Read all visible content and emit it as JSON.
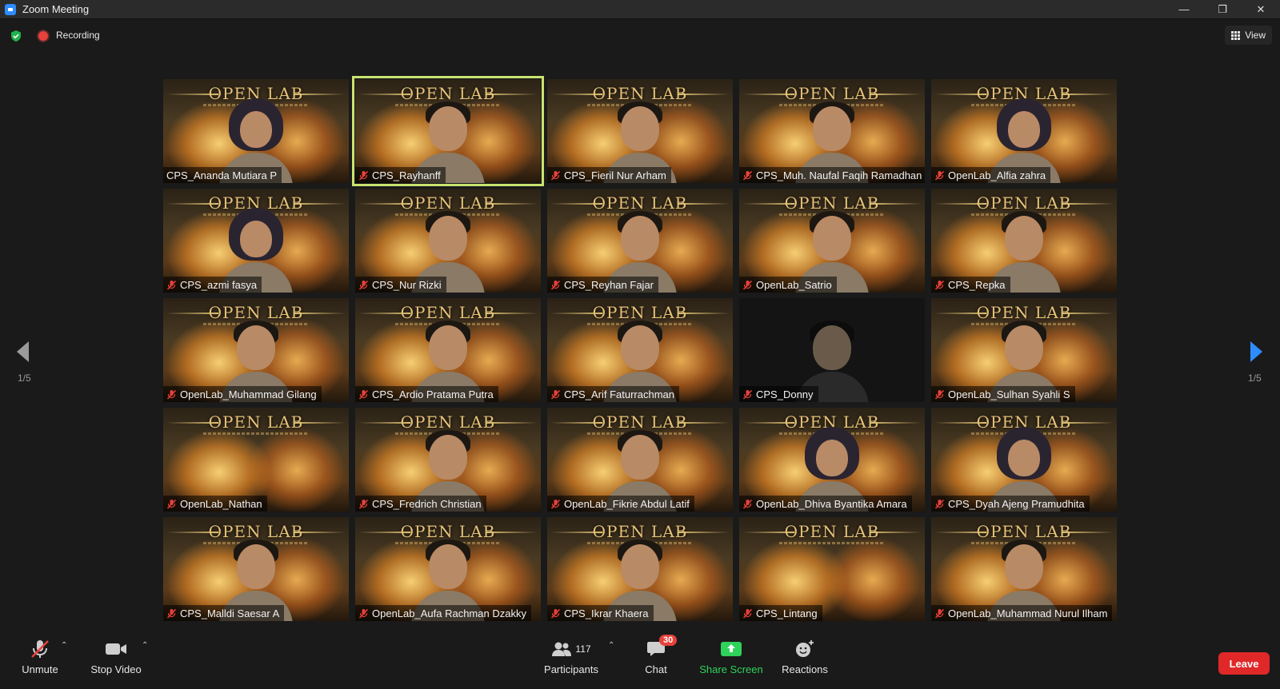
{
  "window": {
    "title": "Zoom Meeting"
  },
  "topbar": {
    "recording_label": "Recording",
    "view_label": "View"
  },
  "pagination": {
    "left_page": "1/5",
    "right_page": "1/5"
  },
  "banner_text": "OPEN LAB",
  "participants_grid": [
    {
      "name": "CPS_Ananda Mutiara P",
      "muted": false,
      "style": "hijab"
    },
    {
      "name": "CPS_Rayhanff",
      "muted": true,
      "style": "person",
      "active_speaker": true
    },
    {
      "name": "CPS_Fieril Nur Arham",
      "muted": true,
      "style": "person"
    },
    {
      "name": "CPS_Muh. Naufal Faqih Ramadhan",
      "muted": true,
      "style": "person"
    },
    {
      "name": "OpenLab_Alfia zahra",
      "muted": true,
      "style": "hijab"
    },
    {
      "name": "CPS_azmi fasya",
      "muted": true,
      "style": "hijab"
    },
    {
      "name": "CPS_Nur Rizki",
      "muted": true,
      "style": "person"
    },
    {
      "name": "CPS_Reyhan Fajar",
      "muted": true,
      "style": "person"
    },
    {
      "name": "OpenLab_Satrio",
      "muted": true,
      "style": "person"
    },
    {
      "name": "CPS_Repka",
      "muted": true,
      "style": "person"
    },
    {
      "name": "OpenLab_Muhammad Gilang",
      "muted": true,
      "style": "person"
    },
    {
      "name": "CPS_Ardio Pratama Putra",
      "muted": true,
      "style": "person",
      "highlighted": true
    },
    {
      "name": "CPS_Arif Faturrachman",
      "muted": true,
      "style": "person"
    },
    {
      "name": "CPS_Donny",
      "muted": true,
      "style": "dark"
    },
    {
      "name": "OpenLab_Sulhan Syahli S",
      "muted": true,
      "style": "person"
    },
    {
      "name": "OpenLab_Nathan",
      "muted": true,
      "style": "banner-only"
    },
    {
      "name": "CPS_Fredrich Christian",
      "muted": true,
      "style": "person"
    },
    {
      "name": "OpenLab_Fikrie Abdul Latif",
      "muted": true,
      "style": "person"
    },
    {
      "name": "OpenLab_Dhiva Byantika Amara",
      "muted": true,
      "style": "hijab"
    },
    {
      "name": "CPS_Dyah Ajeng Pramudhita",
      "muted": true,
      "style": "hijab"
    },
    {
      "name": "CPS_Malldi Saesar A",
      "muted": true,
      "style": "person"
    },
    {
      "name": "OpenLab_Aufa Rachman Dzakky",
      "muted": true,
      "style": "person"
    },
    {
      "name": "CPS_Ikrar Khaera",
      "muted": true,
      "style": "person"
    },
    {
      "name": "CPS_Lintang",
      "muted": true,
      "style": "banner-only"
    },
    {
      "name": "OpenLab_Muhammad Nurul Ilham",
      "muted": true,
      "style": "person"
    }
  ],
  "toolbar": {
    "unmute_label": "Unmute",
    "stop_video_label": "Stop Video",
    "participants_label": "Participants",
    "participants_count": "117",
    "chat_label": "Chat",
    "chat_badge": "30",
    "share_screen_label": "Share Screen",
    "reactions_label": "Reactions",
    "leave_label": "Leave"
  },
  "colors": {
    "accent_share": "#2fd25a",
    "leave": "#e02828",
    "active_speaker": "#c9e36f",
    "recording": "#e8413b"
  }
}
